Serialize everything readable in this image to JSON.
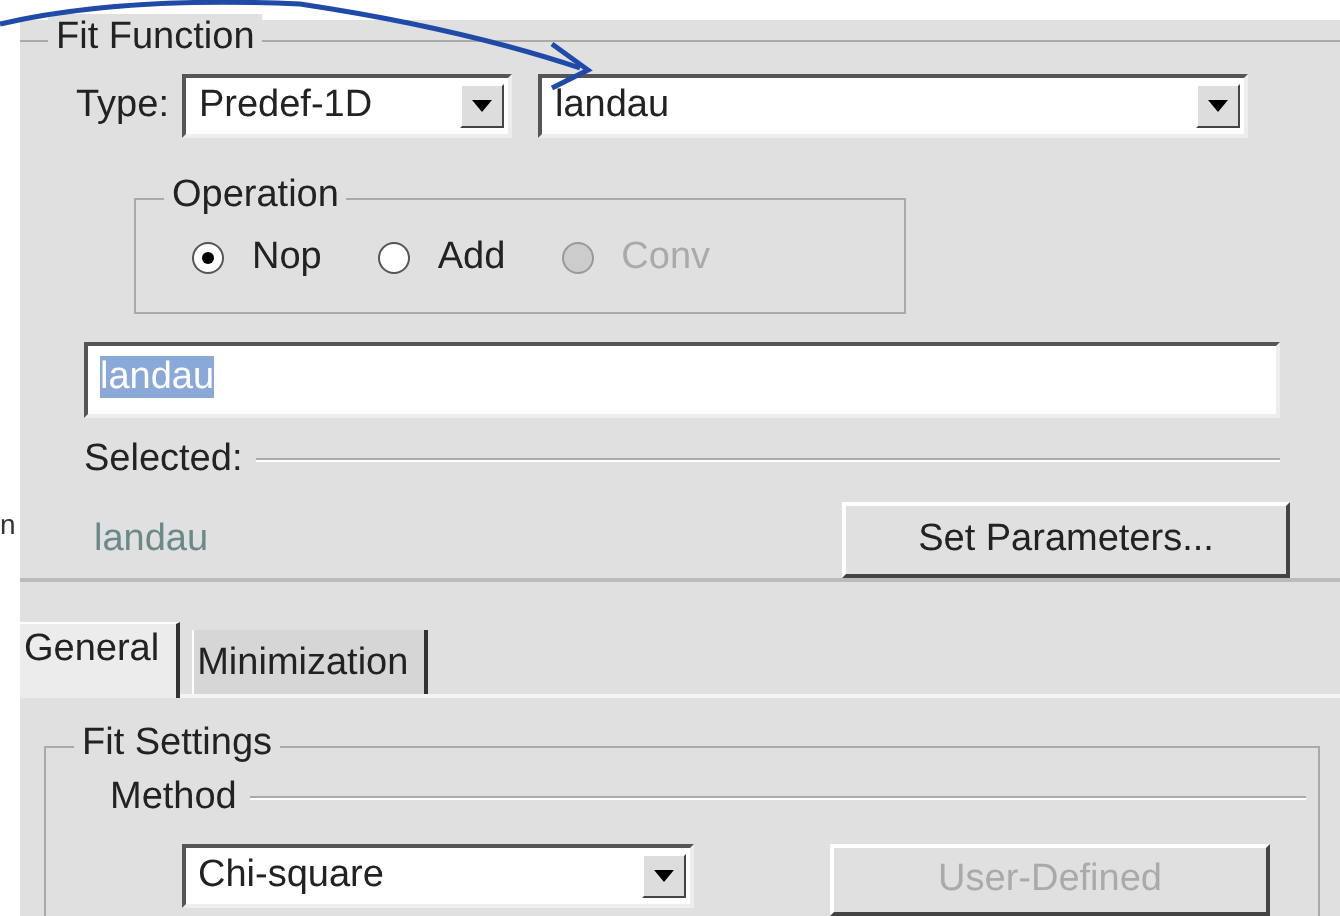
{
  "side_text": "n",
  "fit_function": {
    "title": "Fit Function",
    "type_label": "Type:",
    "type_combo": {
      "value": "Predef-1D"
    },
    "function_combo": {
      "value": "landau"
    },
    "operation": {
      "title": "Operation",
      "options": [
        {
          "label": "Nop",
          "selected": true,
          "disabled": false
        },
        {
          "label": "Add",
          "selected": false,
          "disabled": false
        },
        {
          "label": "Conv",
          "selected": false,
          "disabled": true
        }
      ]
    },
    "expression_field": {
      "value": "landau",
      "text_selected": true
    },
    "selected_label": "Selected:",
    "selected_value": "landau",
    "set_parameters_button": "Set Parameters..."
  },
  "tabs": [
    {
      "label": "General",
      "selected": true
    },
    {
      "label": "Minimization",
      "selected": false
    }
  ],
  "fit_settings": {
    "title": "Fit Settings",
    "method": {
      "title": "Method",
      "combo": {
        "value": "Chi-square"
      },
      "user_defined_button": {
        "label": "User-Defined",
        "disabled": true
      }
    }
  }
}
